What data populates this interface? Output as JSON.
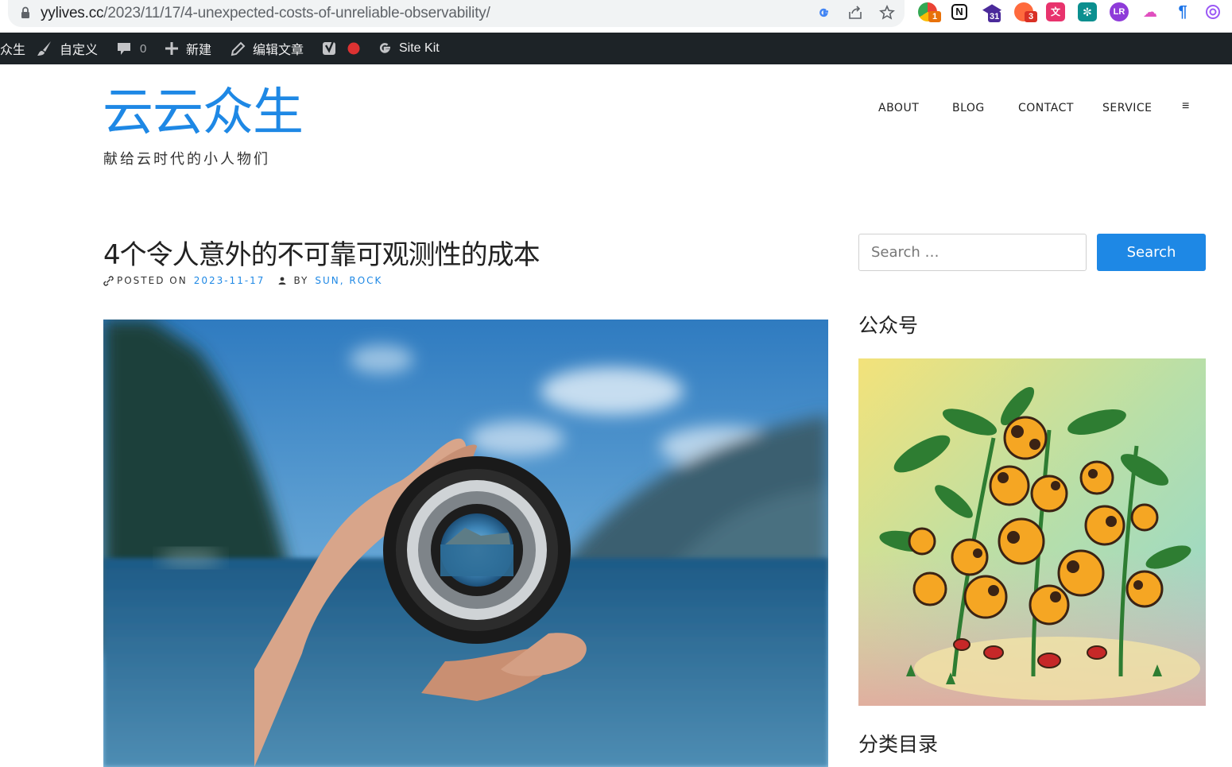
{
  "browser": {
    "url_host": "yylives.cc",
    "url_path": "/2023/11/17/4-unexpected-costs-of-unreliable-observability/",
    "extensions": [
      {
        "icon": "chrome-colorful-extension-icon",
        "badge": "1"
      },
      {
        "icon": "notion-icon",
        "badge": ""
      },
      {
        "icon": "graduation-cap-icon",
        "badge": "31"
      },
      {
        "icon": "orange-extension-icon",
        "badge": "3"
      },
      {
        "icon": "translate-icon",
        "badge": ""
      },
      {
        "icon": "grid-extension-icon",
        "badge": ""
      },
      {
        "icon": "lr-icon",
        "badge": ""
      },
      {
        "icon": "cloud-extension-icon",
        "badge": ""
      },
      {
        "icon": "blue-extension-icon",
        "badge": ""
      },
      {
        "icon": "openai-icon",
        "badge": ""
      }
    ]
  },
  "adminbar": {
    "site_name_partial": "众生",
    "customize": "自定义",
    "comments_count": "0",
    "new": "新建",
    "edit_post": "编辑文章",
    "site_kit": "Site Kit"
  },
  "site": {
    "title": "云云众生",
    "description": "献给云时代的小人物们"
  },
  "nav": {
    "items": [
      "ABOUT",
      "BLOG",
      "CONTACT",
      "SERVICE"
    ],
    "toggle": "≡"
  },
  "post": {
    "title": "4个令人意外的不可靠可观测性的成本",
    "posted_on_label": "POSTED ON",
    "date": "2023-11-17",
    "by_label": "BY",
    "author": "SUN, ROCK"
  },
  "sidebar": {
    "search_placeholder": "Search …",
    "search_button": "Search",
    "widget1_title": "公众号",
    "widget2_title": "分类目录"
  },
  "colors": {
    "accent": "#1e88e5",
    "adminbar": "#1d2327"
  }
}
